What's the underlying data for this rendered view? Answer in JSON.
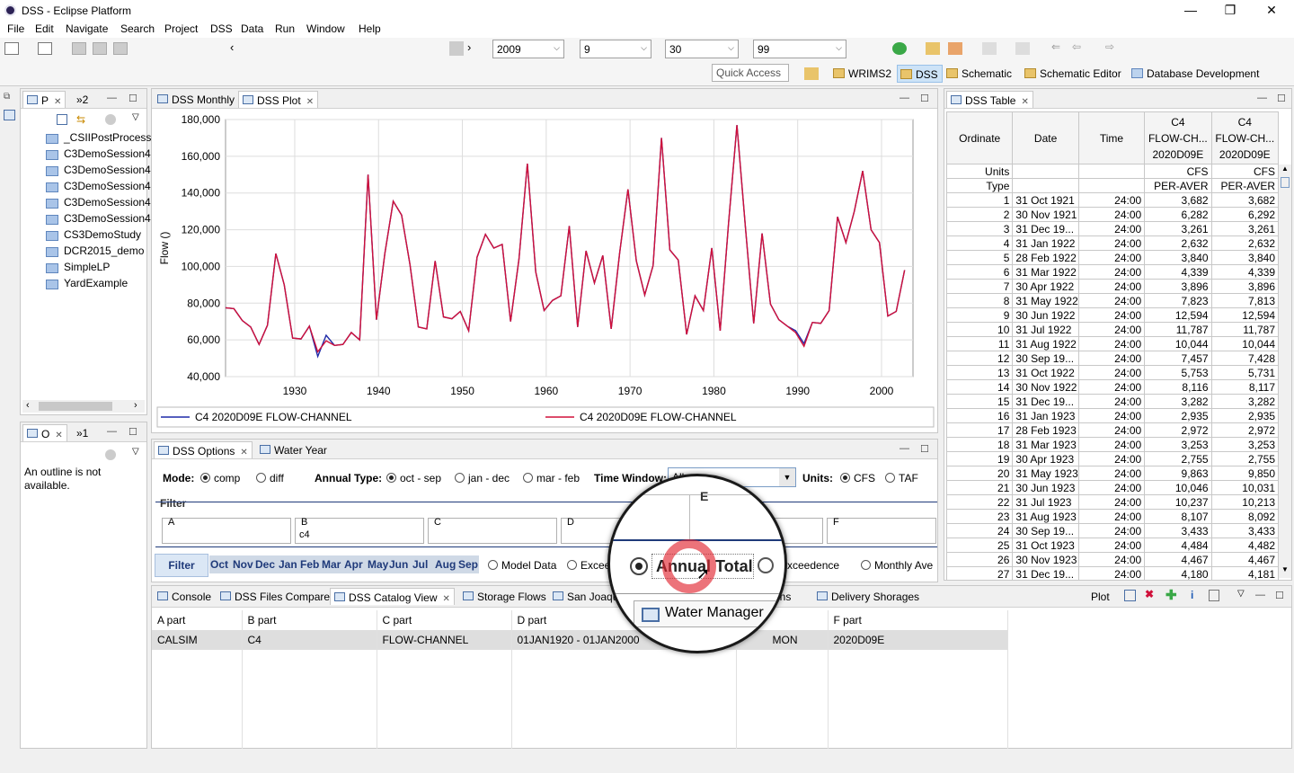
{
  "window": {
    "title": "DSS - Eclipse Platform",
    "minimize": "—",
    "maximize": "❐",
    "close": "✕"
  },
  "menu": [
    "File",
    "Edit",
    "Navigate",
    "Search",
    "Project",
    "DSS",
    "Data",
    "Run",
    "Window",
    "Help"
  ],
  "time_combos": [
    "2009",
    "9",
    "30",
    "99"
  ],
  "quick_access": "Quick Access",
  "perspectives": [
    "WRIMS2",
    "DSS",
    "Schematic",
    "Schematic Editor",
    "Database Development"
  ],
  "project_panel": {
    "tab1": "P",
    "tab2": "»2",
    "items": [
      "_CSIIPostProcessi",
      "C3DemoSession4",
      "C3DemoSession4",
      "C3DemoSession4",
      "C3DemoSession4",
      "C3DemoSession4",
      "CS3DemoStudy",
      "DCR2015_demo",
      "SimpleLP",
      "YardExample"
    ]
  },
  "outline_panel": {
    "tab1": "O",
    "tab2": "»1",
    "message": "An outline is not available."
  },
  "plot_panel": {
    "tabs": [
      "DSS Monthly",
      "DSS Plot"
    ]
  },
  "chart_data": {
    "type": "line",
    "ylabel": "Flow ()",
    "xlim": [
      1921.75,
      2003.75
    ],
    "ylim": [
      40000,
      180000
    ],
    "xticks": [
      1930,
      1940,
      1950,
      1960,
      1970,
      1980,
      1990,
      2000
    ],
    "yticks": [
      "40,000",
      "60,000",
      "80,000",
      "100,000",
      "120,000",
      "140,000",
      "160,000",
      "180,000"
    ],
    "x_start": 1921.75,
    "series": [
      {
        "name": "C4 2020D09E FLOW-CHANNEL",
        "color": "#1f2aa8",
        "values": [
          77500,
          77000,
          70500,
          67000,
          57500,
          68000,
          107000,
          90000,
          61000,
          60500,
          67500,
          51000,
          62500,
          57000,
          57500,
          64000,
          60000,
          150000,
          71000,
          107000,
          135500,
          128000,
          101000,
          67000,
          66000,
          103000,
          72500,
          71500,
          75500,
          65000,
          105000,
          117500,
          110000,
          112000,
          70000,
          104000,
          156000,
          97000,
          76000,
          81500,
          84000,
          122000,
          67000,
          108500,
          91000,
          106000,
          66000,
          107000,
          142000,
          103000,
          84500,
          100500,
          170000,
          109000,
          103500,
          63000,
          84000,
          76000,
          110000,
          65000,
          123500,
          177000,
          122000,
          69000,
          118000,
          79500,
          71000,
          67500,
          65000,
          58000,
          69500,
          69000,
          76000,
          127000,
          113000,
          130000,
          152000,
          120000,
          113000,
          73000,
          75500,
          98000
        ]
      },
      {
        "name": "C4 2020D09E FLOW-CHANNEL",
        "color": "#d0103a",
        "values": [
          77500,
          77000,
          70500,
          67000,
          57500,
          68000,
          107000,
          90000,
          61000,
          60500,
          67500,
          53500,
          59500,
          57000,
          57500,
          64000,
          60000,
          150000,
          71000,
          107000,
          135500,
          128000,
          101000,
          67000,
          66000,
          103000,
          72500,
          71500,
          75500,
          65000,
          105000,
          117500,
          110000,
          112000,
          70000,
          104000,
          156000,
          97000,
          76000,
          81500,
          84000,
          122000,
          67000,
          108500,
          91000,
          106000,
          66000,
          107000,
          142000,
          103000,
          84500,
          100500,
          170000,
          109000,
          103500,
          63000,
          84000,
          76000,
          110000,
          65000,
          123500,
          177000,
          122000,
          69000,
          118000,
          79500,
          71000,
          67500,
          64000,
          56500,
          69500,
          69000,
          76000,
          127000,
          113000,
          130000,
          152000,
          120000,
          113000,
          73000,
          75500,
          98000
        ]
      }
    ]
  },
  "options_panel": {
    "tabs": [
      "DSS Options",
      "Water Year"
    ],
    "mode_label": "Mode:",
    "mode_opts": [
      "comp",
      "diff"
    ],
    "annual_label": "Annual Type:",
    "annual_opts": [
      "oct - sep",
      "jan - dec",
      "mar - feb"
    ],
    "time_window_label": "Time Window:",
    "time_window_value": "All",
    "units_label": "Units:",
    "units_opts": [
      "CFS",
      "TAF"
    ],
    "filter_title": "Filter",
    "filter_parts": [
      {
        "label": "A",
        "value": ""
      },
      {
        "label": "B",
        "value": "c4"
      },
      {
        "label": "C",
        "value": ""
      },
      {
        "label": "D",
        "value": ""
      },
      {
        "label": "E",
        "value": ""
      },
      {
        "label": "F",
        "value": ""
      }
    ],
    "filter_button": "Filter",
    "months": [
      "Oct",
      "Nov",
      "Dec",
      "Jan",
      "Feb",
      "Mar",
      "Apr",
      "May",
      "Jun",
      "Jul",
      "Aug",
      "Sep"
    ],
    "view_opts": [
      "Model Data",
      "Exceedence",
      "Annual Total",
      "Exceedence",
      "Monthly Ave"
    ]
  },
  "magnifier": {
    "col_label": "E",
    "radio_label": "Annual Total",
    "tab_label": "Water Manager"
  },
  "table_panel": {
    "tab": "DSS Table",
    "headers": {
      "ordinate": "Ordinate",
      "date": "Date",
      "time": "Time",
      "col1": [
        "C4",
        "FLOW-CH...",
        "2020D09E"
      ],
      "col2": [
        "C4",
        "FLOW-CH...",
        "2020D09E"
      ]
    },
    "units_label": "Units",
    "units": [
      "CFS",
      "CFS"
    ],
    "type_label": "Type",
    "types": [
      "PER-AVER",
      "PER-AVER"
    ],
    "rows": [
      [
        "1",
        "31 Oct 1921",
        "24:00",
        "3,682",
        "3,682"
      ],
      [
        "2",
        "30 Nov 1921",
        "24:00",
        "6,282",
        "6,292"
      ],
      [
        "3",
        "31 Dec 19...",
        "24:00",
        "3,261",
        "3,261"
      ],
      [
        "4",
        "31 Jan 1922",
        "24:00",
        "2,632",
        "2,632"
      ],
      [
        "5",
        "28 Feb 1922",
        "24:00",
        "3,840",
        "3,840"
      ],
      [
        "6",
        "31 Mar 1922",
        "24:00",
        "4,339",
        "4,339"
      ],
      [
        "7",
        "30 Apr 1922",
        "24:00",
        "3,896",
        "3,896"
      ],
      [
        "8",
        "31 May 1922",
        "24:00",
        "7,823",
        "7,813"
      ],
      [
        "9",
        "30 Jun 1922",
        "24:00",
        "12,594",
        "12,594"
      ],
      [
        "10",
        "31 Jul 1922",
        "24:00",
        "11,787",
        "11,787"
      ],
      [
        "11",
        "31 Aug 1922",
        "24:00",
        "10,044",
        "10,044"
      ],
      [
        "12",
        "30 Sep 19...",
        "24:00",
        "7,457",
        "7,428"
      ],
      [
        "13",
        "31 Oct 1922",
        "24:00",
        "5,753",
        "5,731"
      ],
      [
        "14",
        "30 Nov 1922",
        "24:00",
        "8,116",
        "8,117"
      ],
      [
        "15",
        "31 Dec 19...",
        "24:00",
        "3,282",
        "3,282"
      ],
      [
        "16",
        "31 Jan 1923",
        "24:00",
        "2,935",
        "2,935"
      ],
      [
        "17",
        "28 Feb 1923",
        "24:00",
        "2,972",
        "2,972"
      ],
      [
        "18",
        "31 Mar 1923",
        "24:00",
        "3,253",
        "3,253"
      ],
      [
        "19",
        "30 Apr 1923",
        "24:00",
        "2,755",
        "2,755"
      ],
      [
        "20",
        "31 May 1923",
        "24:00",
        "9,863",
        "9,850"
      ],
      [
        "21",
        "30 Jun 1923",
        "24:00",
        "10,046",
        "10,031"
      ],
      [
        "22",
        "31 Jul 1923",
        "24:00",
        "10,237",
        "10,213"
      ],
      [
        "23",
        "31 Aug 1923",
        "24:00",
        "8,107",
        "8,092"
      ],
      [
        "24",
        "30 Sep 19...",
        "24:00",
        "3,433",
        "3,433"
      ],
      [
        "25",
        "31 Oct 1923",
        "24:00",
        "4,484",
        "4,482"
      ],
      [
        "26",
        "30 Nov 1923",
        "24:00",
        "4,467",
        "4,467"
      ],
      [
        "27",
        "31 Dec 19...",
        "24:00",
        "4,180",
        "4,181"
      ]
    ]
  },
  "bottom_panel": {
    "tabs": [
      "Console",
      "DSS Files Compare",
      "DSS Catalog View",
      "Storage Flows",
      "San Joaqu",
      "ctions",
      "Delivery Shorages"
    ],
    "plot_label": "Plot",
    "columns": [
      "A part",
      "B part",
      "C part",
      "D part",
      "",
      "F part"
    ],
    "row": [
      "CALSIM",
      "C4",
      "FLOW-CHANNEL",
      "01JAN1920 - 01JAN2000",
      "MON",
      "2020D09E"
    ]
  }
}
